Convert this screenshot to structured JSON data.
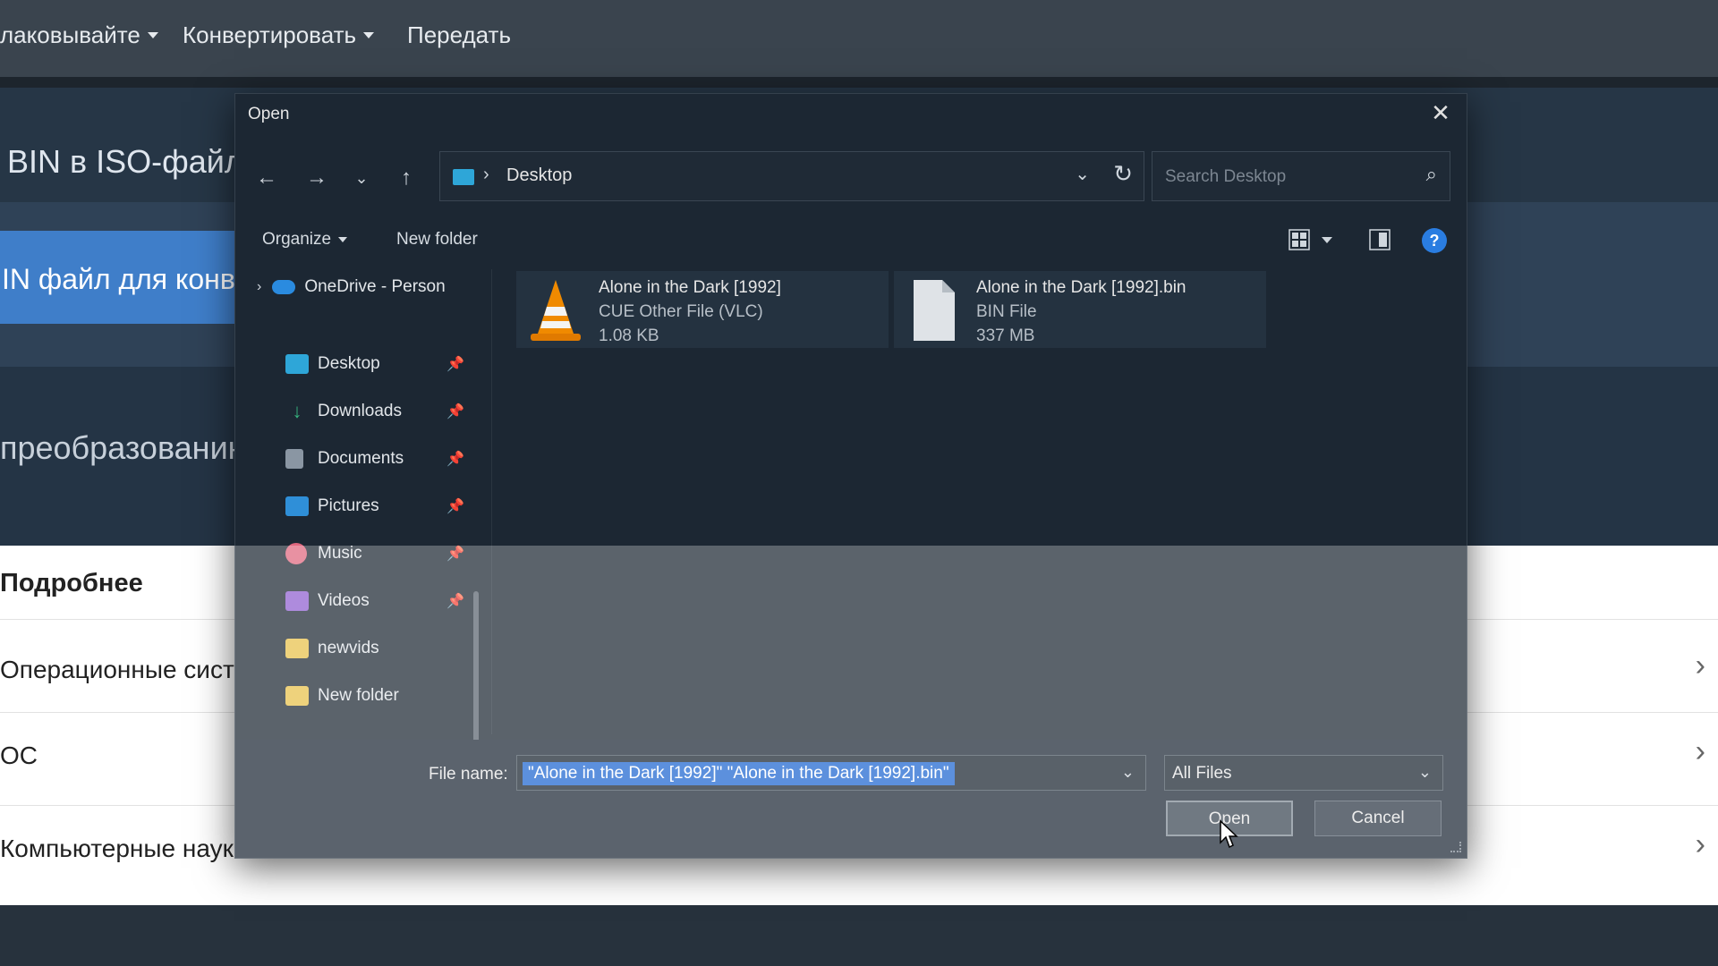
{
  "background_site": {
    "nav": [
      "лаковывайте",
      "Конвертировать",
      "Передать"
    ],
    "hero_title": "BIN в ISO-файл",
    "blue_button_text": "IN файл для конвертации",
    "mid_text": "преобразованию ниже",
    "section_heading": "Подробнее",
    "rows": [
      "Операционные систем",
      "ОС",
      "Компьютерные науки"
    ]
  },
  "dialog": {
    "title": "Open",
    "close_glyph": "✕",
    "address": {
      "separator": "›",
      "location": "Desktop"
    },
    "search_placeholder": "Search Desktop",
    "toolbar": {
      "organize": "Organize",
      "new_folder": "New folder"
    },
    "sidebar": {
      "onedrive": "OneDrive - Person",
      "items": [
        {
          "label": "Desktop",
          "icon": "desktop-icon",
          "color": "#2ea6d8",
          "pinned": true
        },
        {
          "label": "Downloads",
          "icon": "downloads-icon",
          "color": "#36b37e",
          "pinned": true
        },
        {
          "label": "Documents",
          "icon": "documents-icon",
          "color": "#8a96a3",
          "pinned": true
        },
        {
          "label": "Pictures",
          "icon": "pictures-icon",
          "color": "#2f8fd8",
          "pinned": true
        },
        {
          "label": "Music",
          "icon": "music-icon",
          "color": "#e0677f",
          "pinned": true
        },
        {
          "label": "Videos",
          "icon": "videos-icon",
          "color": "#8f5fd0",
          "pinned": true
        },
        {
          "label": "newvids",
          "icon": "folder-icon",
          "color": "#e8c14a",
          "pinned": false
        },
        {
          "label": "New folder",
          "icon": "folder-icon",
          "color": "#e8c14a",
          "pinned": false
        }
      ]
    },
    "files": [
      {
        "name": "Alone in the Dark [1992]",
        "type": "CUE Other File (VLC)",
        "size": "1.08 KB",
        "icon": "vlc-icon"
      },
      {
        "name": "Alone in the Dark [1992].bin",
        "type": "BIN File",
        "size": "337 MB",
        "icon": "file-icon"
      }
    ],
    "file_name_label": "File name:",
    "file_name_value": "\"Alone in the Dark [1992]\" \"Alone in the Dark [1992].bin\"",
    "file_type": "All Files",
    "open_button": "Open",
    "cancel_button": "Cancel"
  }
}
